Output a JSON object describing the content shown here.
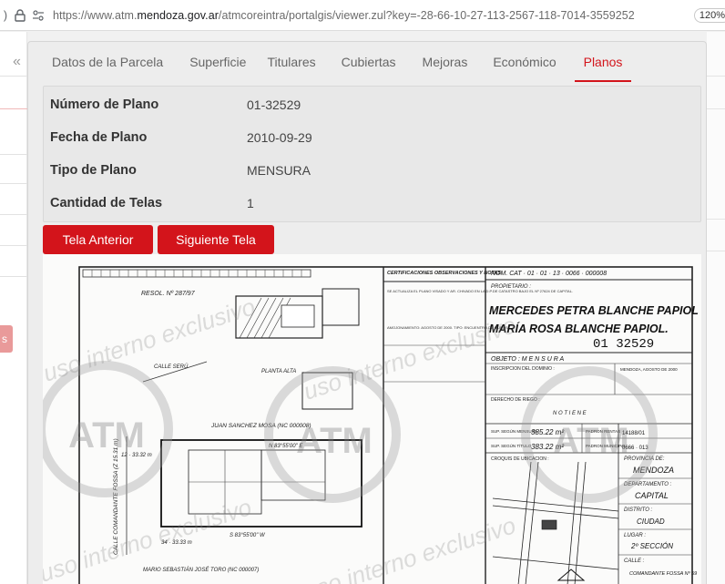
{
  "browser": {
    "url_prefix": "https://www.atm.",
    "url_host": "mendoza.gov.ar",
    "url_rest": "/atmcoreintra/portalgis/viewer.zul?key=-28-66-10-27-113-2567-118-7014-3559252",
    "zoom": "120%"
  },
  "tabs": [
    {
      "label": "Datos de la Parcela"
    },
    {
      "label": "Superficie"
    },
    {
      "label": "Titulares"
    },
    {
      "label": "Cubiertas"
    },
    {
      "label": "Mejoras"
    },
    {
      "label": "Económico"
    },
    {
      "label": "Planos",
      "active": true
    }
  ],
  "info": {
    "numero_label": "Número de Plano",
    "numero_value": "01-32529",
    "fecha_label": "Fecha de Plano",
    "fecha_value": "2010-09-29",
    "tipo_label": "Tipo de Plano",
    "tipo_value": "MENSURA",
    "telas_label": "Cantidad de Telas",
    "telas_value": "1"
  },
  "buttons": {
    "prev": "Tela Anterior",
    "next": "Siguiente Tela"
  },
  "plan": {
    "title_block": {
      "nom_cat": "NOM. CAT · 01 · 01 · 13 · 0066 · 000008",
      "propietario_label": "PROPIETARIO :",
      "owner1": "MERCEDES PETRA BLANCHE PAPIOL",
      "owner2": "MARÍA ROSA BLANCHE PAPIOL.",
      "plan_no": "01   32529",
      "objeto": "OBJETO : M E N S U R A",
      "inscripcion": "INSCRIPCION DEL DOMINIO :",
      "derecho_riego": "DERECHO DE RIEGO :",
      "no_tiene": "N O   T I E N E",
      "sup_mensura_label": "SUP. SEGÚN MENSURA",
      "sup_mensura_value": "385.22 m²",
      "sup_titulo_label": "SUP. SEGÚN TÍTULO",
      "sup_titulo_value": "383.22 m²",
      "padron_rentas_label": "PADRON RENTAS",
      "padron_rentas_value": "14188/01",
      "padron_municipal_label": "PADRON MUNICIPAL",
      "padron_municipal_value": "0666 · 013",
      "croquis": "CROQUIS DE UBICACION :",
      "provincia_label": "PROVINCIA DE:",
      "provincia": "MENDOZA",
      "departamento_label": "DEPARTAMENTO :",
      "departamento": "CAPITAL",
      "distrito_label": "DISTRITO :",
      "distrito": "CIUDAD",
      "lugar_label": "LUGAR :",
      "lugar": "2º SECCIÓN",
      "calle_label": "CALLE :",
      "calle": "COMANDANTE FOSSA Nº 59",
      "mendoza_fecha": "MENDOZA, AGOSTO DE 2000",
      "cert_header": "CERTIFICACIONES OBSERVACIONES Y NOTAS",
      "cert_note1": "SE ACTUALIZA EL PLANO VISADO Y AR. CHIVADO EN LA D.P.DE CATASTRO BAJO EL Nº 27624 DE CAPITAL.",
      "cert_note2": "AMOJONAMIENTO: AGOSTO DE 2000. TIPO: ENCUENTRO DE MUROS"
    },
    "drawing": {
      "resol": "RESOL. Nº 287/97",
      "calle_seru": "CALLE SERÚ",
      "planta_alta": "PLANTA ALTA",
      "neighbor_top": "JUAN SANCHEZ MOSA (NC 000008)",
      "neighbor_bottom": "MARIO SEBASTIÁN JOSÉ TORO (NC 000007)",
      "street_left": "CALLE COMANDANTE FOSSA (Z 15.31 m)",
      "bearing_top": "N 83°55'00\" E",
      "bearing_bottom": "S 83°55'00\" W",
      "dim_top": "12 · 33.32 m",
      "dim_bottom": "34 · 33.33 m"
    },
    "watermark_logo": "ATM",
    "watermark_text": "uso interno exclusivo"
  }
}
